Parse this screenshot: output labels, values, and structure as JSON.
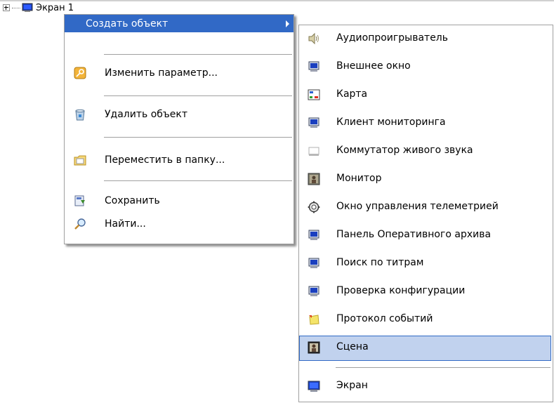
{
  "tree": {
    "node_label": "Экран 1"
  },
  "context_menu": {
    "create_object": "Создать объект",
    "edit_parameter": "Изменить параметр...",
    "delete_object": "Удалить объект",
    "move_to_folder": "Переместить в папку...",
    "save": "Сохранить",
    "find": "Найти..."
  },
  "submenu": {
    "items": [
      {
        "label": "Аудиопроигрыватель",
        "icon": "speaker-icon"
      },
      {
        "label": "Внешнее окно",
        "icon": "monitor-icon"
      },
      {
        "label": "Карта",
        "icon": "map-icon"
      },
      {
        "label": "Клиент мониторинга",
        "icon": "monitor-icon"
      },
      {
        "label": "Коммутатор живого звука",
        "icon": "blank-window-icon"
      },
      {
        "label": "Монитор",
        "icon": "camera-monitor-icon"
      },
      {
        "label": "Окно управления телеметрией",
        "icon": "telemetry-icon"
      },
      {
        "label": "Панель Оперативного архива",
        "icon": "monitor-icon"
      },
      {
        "label": "Поиск по титрам",
        "icon": "monitor-icon"
      },
      {
        "label": "Проверка конфигурации",
        "icon": "monitor-icon"
      },
      {
        "label": "Протокол событий",
        "icon": "event-log-icon"
      },
      {
        "label": "Сцена",
        "icon": "scene-icon"
      },
      {
        "label": "Экран",
        "icon": "screen-icon"
      }
    ],
    "selected": "Сцена"
  },
  "colors": {
    "highlight": "#3169c6",
    "selection_fill": "#c1d2ee",
    "selection_border": "#316ac5"
  }
}
